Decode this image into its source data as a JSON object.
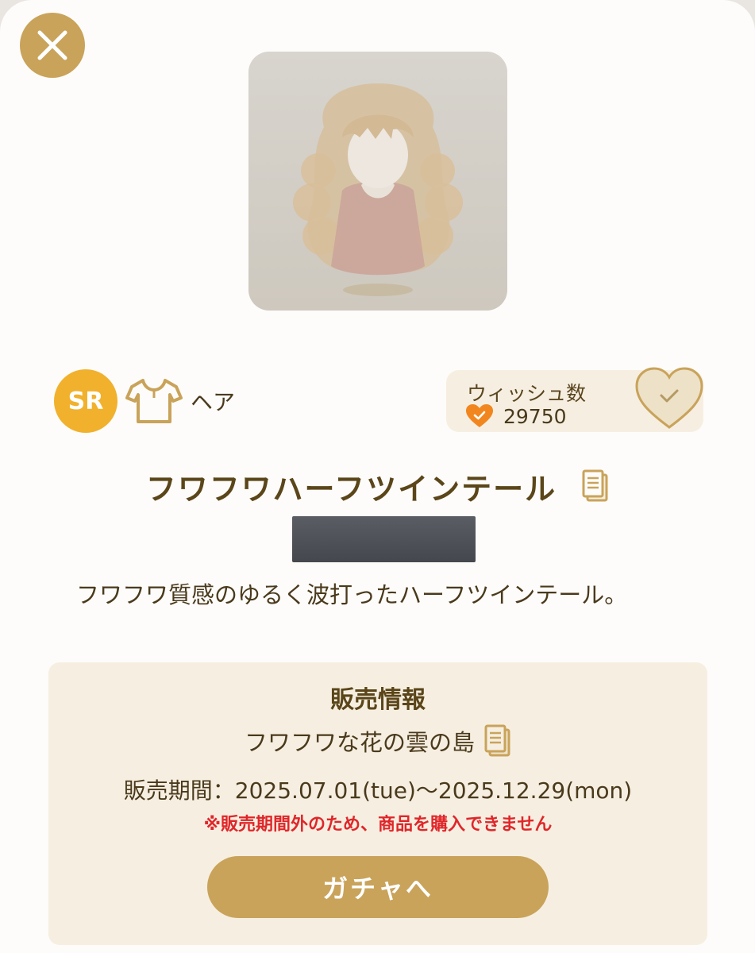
{
  "header": {
    "close_icon": "close-icon"
  },
  "item": {
    "rarity": "SR",
    "category_icon": "shirt-icon",
    "category": "ヘア",
    "name": "フワフワハーフツインテール",
    "description": "フワフワ質感のゆるく波打ったハーフツインテール。"
  },
  "wish": {
    "label": "ウィッシュ数",
    "count": "29750"
  },
  "sale": {
    "heading": "販売情報",
    "location": "フワフワな花の雲の島",
    "period": "販売期間：2025.07.01(tue)〜2025.12.29(mon)",
    "warning": "※販売期間外のため、商品を購入できません",
    "gacha_button": "ガチャへ"
  },
  "colors": {
    "accent_gold": "#c9a35a",
    "rarity_sr": "#f1b12d",
    "heart_orange": "#f2861e",
    "warning_red": "#e0262a",
    "panel_beige": "#f6efe1",
    "text_brown": "#5b461a"
  }
}
